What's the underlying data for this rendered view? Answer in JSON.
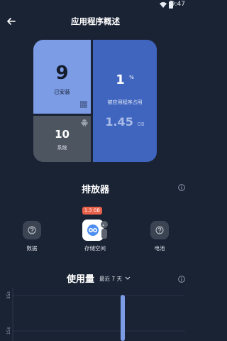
{
  "status_bar": {
    "time": "9:47",
    "icons": [
      "wifi-icon",
      "battery-icon"
    ]
  },
  "header": {
    "title": "应用程序概述",
    "back_icon": "back-arrow-icon"
  },
  "overview": {
    "installed": {
      "value": "9",
      "label": "已安装",
      "icon": "grid-icon"
    },
    "system": {
      "value": "10",
      "label": "系统",
      "icon": "android-icon"
    },
    "used": {
      "percent_value": "1",
      "percent_unit": "%",
      "label": "被应用程序占用",
      "size_value": "1.45",
      "size_unit": "GB"
    },
    "colors": {
      "installed_tile": "#7c9ce6",
      "system_tile": "#4d5561",
      "used_tile": "#3f65bf"
    }
  },
  "drain": {
    "title": "排放器",
    "info_icon": "info-icon",
    "categories": [
      {
        "label": "数据",
        "icon": "question-icon"
      },
      {
        "label": "存储空间",
        "icon": "storage-app-icon",
        "badge": "1.3 GB"
      },
      {
        "label": "电池",
        "icon": "question-icon"
      }
    ],
    "badge_color": "#e8614a"
  },
  "usage": {
    "title": "使用量",
    "range": "最近 7 天",
    "range_icon": "chevron-down-icon",
    "info_icon": "info-icon"
  },
  "chart_data": {
    "type": "bar",
    "title": "",
    "yticks": [
      "35s",
      "15s"
    ],
    "values_visible": [
      {
        "bar": 1,
        "value_hint": "above 35s"
      }
    ],
    "grid": true
  }
}
